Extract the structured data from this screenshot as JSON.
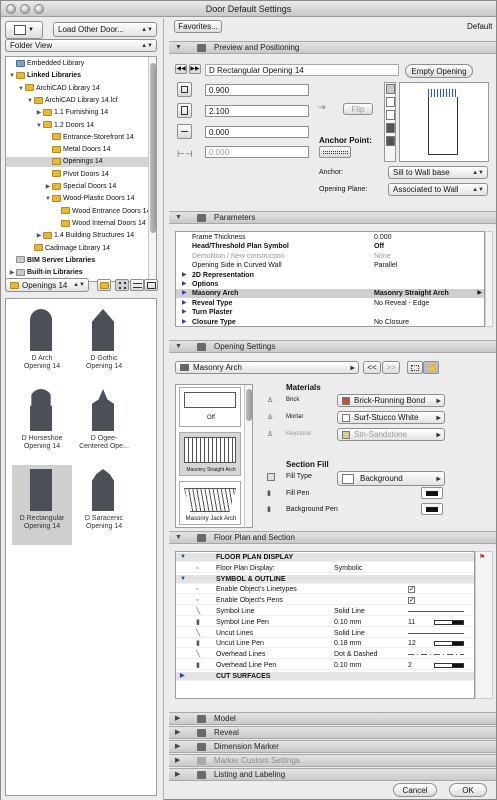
{
  "window": {
    "title": "Door Default Settings"
  },
  "left": {
    "load_popup": "Load Other Door...",
    "view_popup": "Folder View",
    "tree": [
      {
        "label": "Embedded Library",
        "indent": 0,
        "kind": "blue",
        "tri": ""
      },
      {
        "label": "Linked Libraries",
        "indent": 0,
        "kind": "yellow",
        "tri": "▼",
        "bold": true
      },
      {
        "label": "ArchiCAD Library 14",
        "indent": 1,
        "kind": "yellow",
        "tri": "▼"
      },
      {
        "label": "ArchiCAD Library 14.lcf",
        "indent": 2,
        "kind": "yellow",
        "tri": "▼"
      },
      {
        "label": "1.1 Furnishing 14",
        "indent": 3,
        "kind": "yellow",
        "tri": "▶"
      },
      {
        "label": "1.2 Doors 14",
        "indent": 3,
        "kind": "yellow",
        "tri": "▼"
      },
      {
        "label": "Entrance-Storefront 14",
        "indent": 4,
        "kind": "yellow",
        "tri": ""
      },
      {
        "label": "Metal Doors 14",
        "indent": 4,
        "kind": "yellow",
        "tri": ""
      },
      {
        "label": "Openings 14",
        "indent": 4,
        "kind": "yellow",
        "tri": "",
        "selected": true
      },
      {
        "label": "Pivot Doors 14",
        "indent": 4,
        "kind": "yellow",
        "tri": ""
      },
      {
        "label": "Special Doors 14",
        "indent": 4,
        "kind": "yellow",
        "tri": "▶"
      },
      {
        "label": "Wood-Plastic Doors 14",
        "indent": 4,
        "kind": "yellow",
        "tri": "▼"
      },
      {
        "label": "Wood Entrance Doors 14",
        "indent": 5,
        "kind": "yellow",
        "tri": ""
      },
      {
        "label": "Wood Internal Doors 14",
        "indent": 5,
        "kind": "yellow",
        "tri": ""
      },
      {
        "label": "1.4 Building Structures 14",
        "indent": 3,
        "kind": "yellow",
        "tri": "▶"
      },
      {
        "label": "Cadimage Library 14",
        "indent": 2,
        "kind": "yellow",
        "tri": ""
      },
      {
        "label": "BIM Server Libraries",
        "indent": 0,
        "kind": "gray",
        "tri": "",
        "bold": true
      },
      {
        "label": "Built-in Libraries",
        "indent": 0,
        "kind": "gray",
        "tri": "▶",
        "bold": true
      }
    ],
    "folder_popup": "Openings 14",
    "thumbnails": [
      {
        "label": "D Arch\nOpening 14",
        "shape": "arch"
      },
      {
        "label": "D Gothic\nOpening 14",
        "shape": "gothic"
      },
      {
        "label": "D Horseshoe\nOpening 14",
        "shape": "horseshoe"
      },
      {
        "label": "D Ogee-\nCentered Ope...",
        "shape": "ogee"
      },
      {
        "label": "D Rectangular\nOpening 14",
        "shape": "rect",
        "selected": true
      },
      {
        "label": "D Saracenic\nOpening 14",
        "shape": "saracenic"
      }
    ]
  },
  "right": {
    "favorites_button": "Favorites...",
    "default_label": "Default",
    "preview": {
      "section_title": "Preview and Positioning",
      "object_name": "D Rectangular Opening 14",
      "empty_opening_button": "Empty Opening",
      "width": "0.900",
      "height": "2.100",
      "sill": "0.000",
      "reveal": "0.000",
      "flip_button": "Flip",
      "anchor_point_label": "Anchor Point:",
      "anchor_label": "Anchor:",
      "anchor_value": "Sill to Wall base",
      "opening_plane_label": "Opening Plane:",
      "opening_plane_value": "Associated to Wall"
    },
    "parameters": {
      "section_title": "Parameters",
      "rows": [
        {
          "key": "Frame Thickness",
          "value": "0.000",
          "tri": false
        },
        {
          "key": "Head/Threshold Plan Symbol",
          "value": "Off",
          "tri": false,
          "bold": true
        },
        {
          "key": "Demolition / New construction",
          "value": "None",
          "tri": false,
          "dim": true
        },
        {
          "key": "Opening Side in Curved Wall",
          "value": "Parallel",
          "tri": false
        },
        {
          "key": "2D Representation",
          "value": "",
          "tri": true
        },
        {
          "key": "Options",
          "value": "",
          "tri": true
        },
        {
          "key": "Masonry Arch",
          "value": "Masonry Straight Arch",
          "tri": true,
          "selected": true
        },
        {
          "key": "Reveal Type",
          "value": "No Reveal - Edge",
          "tri": true
        },
        {
          "key": "Turn Plaster",
          "value": "",
          "tri": true
        },
        {
          "key": "Closure Type",
          "value": "No Closure",
          "tri": true
        }
      ]
    },
    "opening_settings": {
      "section_title": "Opening Settings",
      "category_popup": "Masonry Arch",
      "prev_button": "<<",
      "next_button": ">>",
      "styles": [
        "Off",
        "Masonry Straight Arch",
        "Masonry Jack Arch"
      ],
      "materials_title": "Materials",
      "materials": [
        {
          "label": "Brick",
          "value": "Brick-Running Bond",
          "color": "#c0503a"
        },
        {
          "label": "Mortar",
          "value": "Surf-Stucco White",
          "color": "#ffffff"
        },
        {
          "label": "Keystone",
          "value": "Stn-Sandstone",
          "color": "#d8c79a",
          "dim": true
        }
      ],
      "section_fill_title": "Section Fill",
      "fill_type_label": "Fill Type",
      "fill_type_value": "Background",
      "fill_pen_label": "Fill Pen",
      "background_pen_label": "Background Pen"
    },
    "floor_plan": {
      "section_title": "Floor Plan and Section",
      "rows": [
        {
          "cat": true,
          "key": "FLOOR PLAN DISPLAY"
        },
        {
          "key": "Floor Plan Display:",
          "value": "Symbolic",
          "num": ""
        },
        {
          "cat": true,
          "key": "SYMBOL & OUTLINE"
        },
        {
          "key": "Enable Object's Linetypes",
          "value": "",
          "num": "",
          "check": true
        },
        {
          "key": "Enable Object's Pens",
          "value": "",
          "num": "",
          "check": true
        },
        {
          "key": "Symbol Line",
          "value": "Solid Line",
          "num": "",
          "line": true
        },
        {
          "key": "Symbol Line Pen",
          "value": "0.10 mm",
          "num": "11",
          "pen": true
        },
        {
          "key": "Uncut Lines",
          "value": "Solid Line",
          "num": "",
          "line": true
        },
        {
          "key": "Uncut Line Pen",
          "value": "0.18 mm",
          "num": "12",
          "pen": true
        },
        {
          "key": "Overhead Lines",
          "value": "Dot & Dashed",
          "num": "",
          "line": true
        },
        {
          "key": "Overhead Line Pen",
          "value": "0.10 mm",
          "num": "2",
          "pen": true
        },
        {
          "cat": true,
          "key": "CUT SURFACES"
        }
      ]
    },
    "collapsed_sections": [
      {
        "label": "Model",
        "dim": false
      },
      {
        "label": "Reveal",
        "dim": false
      },
      {
        "label": "Dimension Marker",
        "dim": false
      },
      {
        "label": "Marker Custom Settings",
        "dim": true
      },
      {
        "label": "Listing and Labeling",
        "dim": false
      }
    ],
    "cancel_button": "Cancel",
    "ok_button": "OK"
  }
}
